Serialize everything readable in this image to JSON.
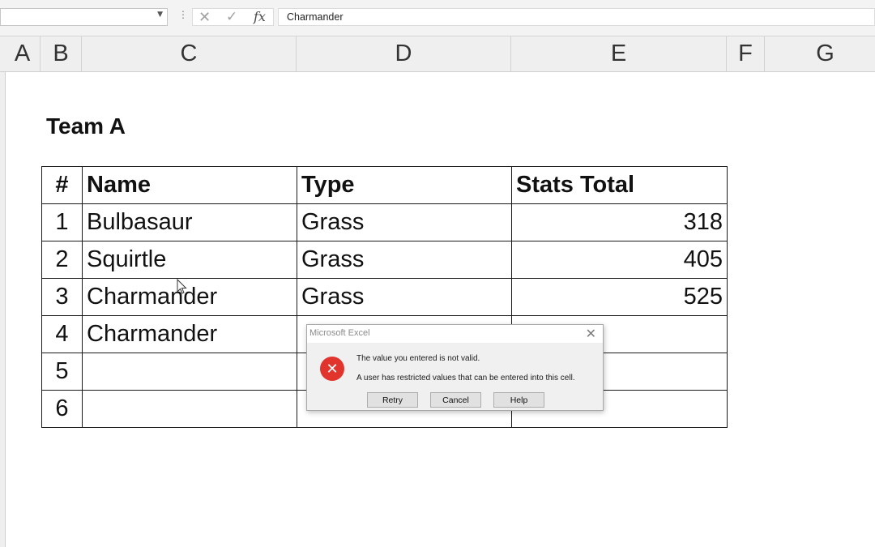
{
  "formula_bar": {
    "name_box": "",
    "cancel_symbol": "✕",
    "enter_symbol": "✓",
    "fx_label": "fx",
    "content": "Charmander"
  },
  "columns": [
    "A",
    "B",
    "C",
    "D",
    "E",
    "F",
    "G"
  ],
  "sheet": {
    "title": "Team A",
    "headers": [
      "#",
      "Name",
      "Type",
      "Stats Total"
    ],
    "rows": [
      {
        "num": "1",
        "name": "Bulbasaur",
        "type": "Grass",
        "stats": "318"
      },
      {
        "num": "2",
        "name": "Squirtle",
        "type": "Grass",
        "stats": "405"
      },
      {
        "num": "3",
        "name": "Charmander",
        "type": "Grass",
        "stats": "525"
      },
      {
        "num": "4",
        "name": "Charmander",
        "type": "",
        "stats": ""
      },
      {
        "num": "5",
        "name": "",
        "type": "",
        "stats": ""
      },
      {
        "num": "6",
        "name": "",
        "type": "",
        "stats": ""
      }
    ]
  },
  "dialog": {
    "title": "Microsoft Excel",
    "icon": "error-icon",
    "message_line1": "The value you entered is not valid.",
    "message_line2": "A user has restricted values that can be entered into this cell.",
    "buttons": {
      "retry": "Retry",
      "cancel": "Cancel",
      "help": "Help"
    },
    "icon_color": "#e0342d"
  }
}
